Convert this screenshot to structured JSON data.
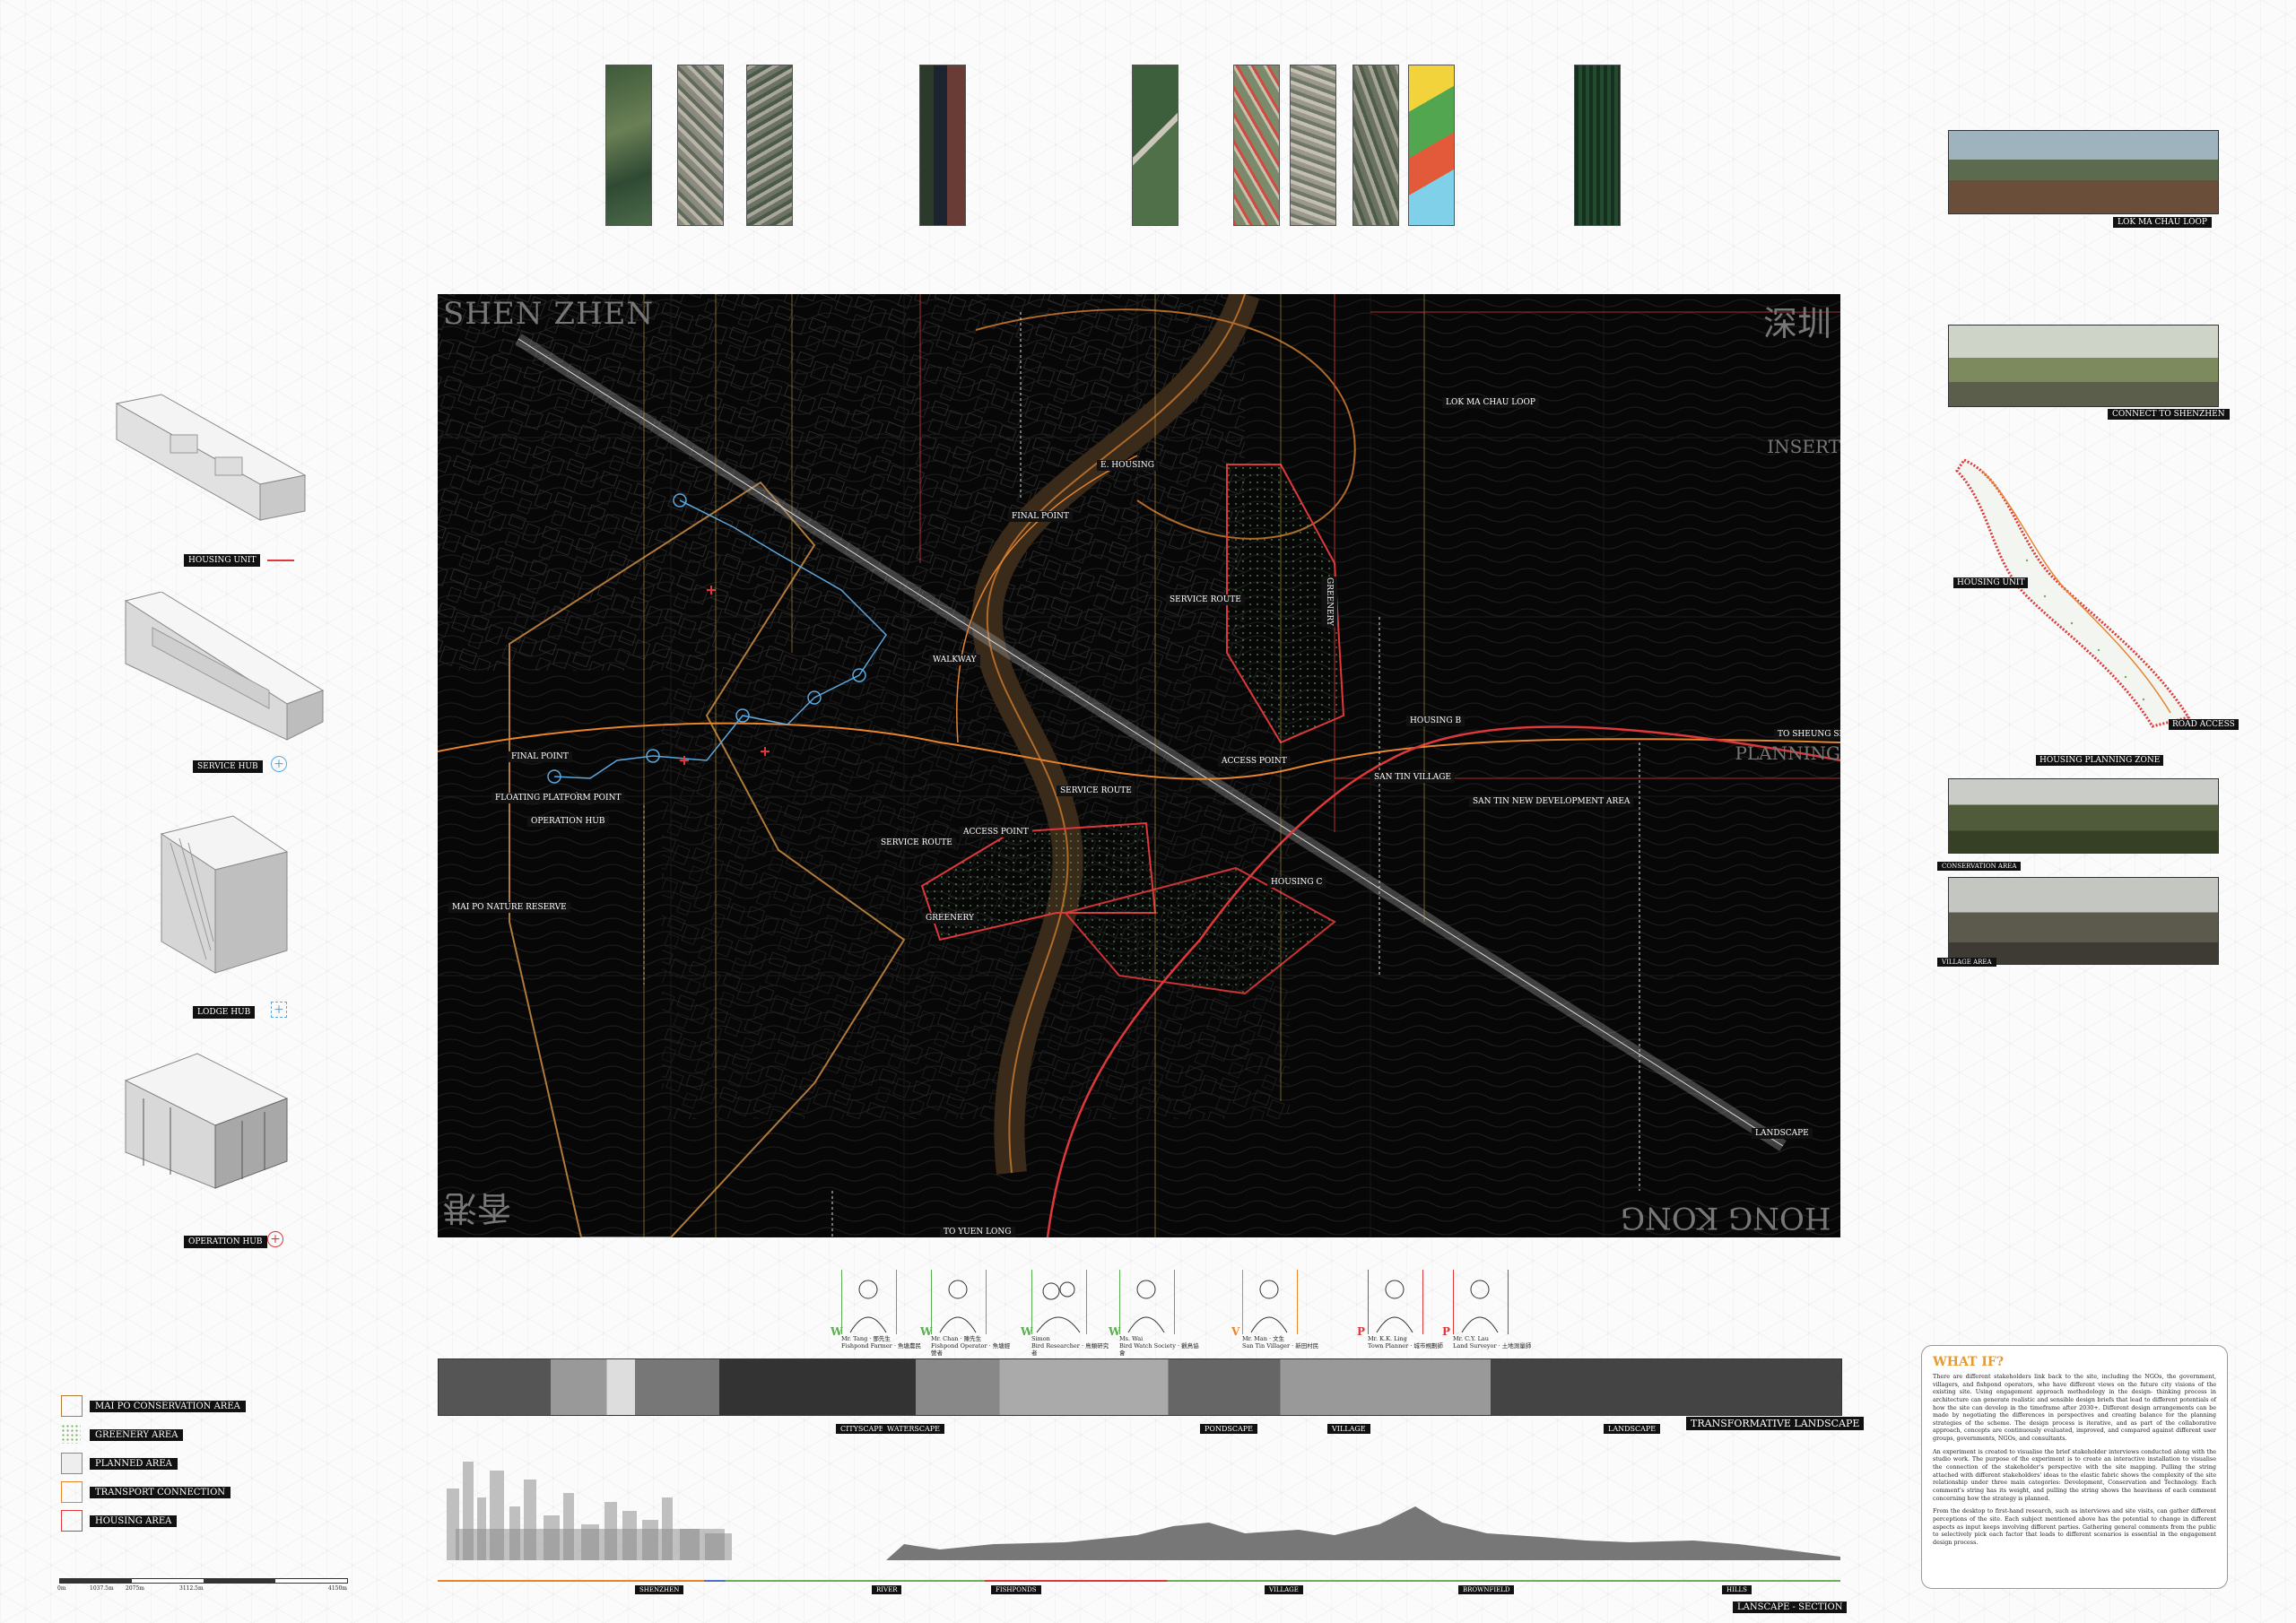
{
  "map": {
    "corner_labels": {
      "shenzhen_en": "SHEN ZHEN",
      "shenzhen_cn": "深圳",
      "hongkong_en": "HONG KONG",
      "hongkong_cn": "香港"
    },
    "side_labels": {
      "insert": "INSERT",
      "planning": "PLANNING"
    },
    "labels": {
      "lok_ma_chau_loop": "LOK MA CHAU LOOP",
      "housing_e": "E. HOUSING",
      "final_point_top": "FINAL POINT",
      "service_route_top": "SERVICE ROUTE",
      "greenery_top": "GREENERY",
      "walkway": "WALKWAY",
      "housing_b": "HOUSING B",
      "to_sheung_shui": "TO SHEUNG SHUI",
      "final_point_left": "FINAL POINT",
      "access_point_mid": "ACCESS POINT",
      "san_tin_village": "SAN TIN VILLAGE",
      "floating_platform": "FLOATING PLATFORM POINT",
      "service_route_mid": "SERVICE ROUTE",
      "san_tin_dev": "SAN TIN NEW DEVELOPMENT AREA",
      "operation_hub": "OPERATION HUB",
      "access_point_low": "ACCESS POINT",
      "service_route_low": "SERVICE ROUTE",
      "housing_c": "HOUSING C",
      "mai_po": "MAI PO NATURE RESERVE",
      "greenery_low": "GREENERY",
      "landscape": "LANDSCAPE",
      "to_yuen_long": "TO YUEN LONG"
    }
  },
  "hubs": [
    {
      "label": "HOUSING UNIT",
      "icon": "red-line-icon"
    },
    {
      "label": "SERVICE HUB",
      "icon": "blue-plus-circle-icon"
    },
    {
      "label": "LODGE HUB",
      "icon": "blue-bracket-plus-icon"
    },
    {
      "label": "OPERATION HUB",
      "icon": "red-plus-circle-icon"
    }
  ],
  "photos": [
    {
      "caption": "LOK MA CHAU LOOP"
    },
    {
      "caption": "CONNECT TO SHENZHEN"
    },
    {
      "caption": "CONSERVATION AREA"
    },
    {
      "caption": "VILLAGE AREA"
    }
  ],
  "housing_plan": {
    "unit_label": "HOUSING UNIT",
    "zone_label": "HOUSING PLANNING ZONE",
    "road_label": "ROAD ACCESS"
  },
  "legend": [
    {
      "label": "MAI PO CONSERVATION AREA",
      "color": "#b07a3a"
    },
    {
      "label": "GREENERY AREA",
      "color": "#6cae5a"
    },
    {
      "label": "PLANNED AREA",
      "color": "#888888"
    },
    {
      "label": "TRANSPORT CONNECTION",
      "color": "#e8842e"
    },
    {
      "label": "HOUSING AREA",
      "color": "#e0383a"
    }
  ],
  "stakeholders": [
    {
      "initial": "W",
      "name": "Mr. Tang · 鄧先生",
      "role": "Fishpond Farmer · 魚塘農民",
      "color": "#5cae52"
    },
    {
      "initial": "W",
      "name": "Mr. Chan · 陳先生",
      "role": "Fishpond Operator · 魚塘經營者",
      "color": "#5cae52"
    },
    {
      "initial": "W",
      "name": "Simon",
      "role": "Bird Researcher · 鳥類研究者",
      "color": "#5cae52"
    },
    {
      "initial": "W",
      "name": "Ms. Wai",
      "role": "Bird Watch Society · 觀鳥協會",
      "color": "#5cae52"
    },
    {
      "initial": "V",
      "name": "Mr. Man · 文生",
      "role": "San Tin Villager · 新田村民",
      "color": "#e8842e"
    },
    {
      "initial": "P",
      "name": "Mr. K.K. Ling",
      "role": "Town Planner · 城市規劃師",
      "color": "#e0383a"
    },
    {
      "initial": "P",
      "name": "Mr. C.Y. Lau",
      "role": "Land Surveyor · 土地測量師",
      "color": "#e0383a"
    }
  ],
  "section": {
    "strip_labels": [
      "CITYSCAPE",
      "WATERSCAPE",
      "PONDSCAPE",
      "VILLAGE",
      "LANDSCAPE"
    ],
    "title": "TRANSFORMATIVE LANDSCAPE",
    "zones": [
      "SHENZHEN",
      "RIVER",
      "FISHPONDS",
      "VILLAGE",
      "BROWNFIELD",
      "HILLS"
    ],
    "caption": "LANSCAPE - SECTION"
  },
  "scale_bar": [
    "0m",
    "1037.5m",
    "2075m",
    "3112.5m",
    "4150m"
  ],
  "what_if": {
    "title": "WHAT IF?",
    "p1": "There are different stakeholders link back to the site, including the NGOs, the government, villagers, and fishpond operators, who have different views on the future city visions of the existing site. Using engagement approach methodology in the design- thinking process in architecture can generate realistic and sensible design briefs that lead to different potentials of how the site can develop in the timeframe after 2030+. Different design arrangements can be made by negotiating the differences in perspectives and creating balance for the planning strategies of the scheme. The design process is iterative, and as part of the collaborative approach, concepts are continuously evaluated, improved, and compared against different user groups, governments, NGOs, and consultants.",
    "p2": "An experiment is created to visualise the brief stakeholder interviews conducted along with the studio work. The purpose of the experiment is to create an interactive installation to visualise the connection of the stakeholder's perspective with the site mapping. Pulling the string attached with different stakeholders' ideas to the elastic fabric shows the complexity of the site relationship under three main categories: Development, Conservation and Technology. Each comment's string has its weight, and pulling the string shows the heaviness of each comment concerning how the strategy is planned.",
    "p3": "From the desktop to first-hand research, such as interviews and site visits, can gather different perceptions of the site. Each subject mentioned above has the potential to change in different aspects as input keeps involving different parties. Gathering general comments from the public to selectively pick each factor that leads to different scenarios is essential in the engagement design process."
  }
}
